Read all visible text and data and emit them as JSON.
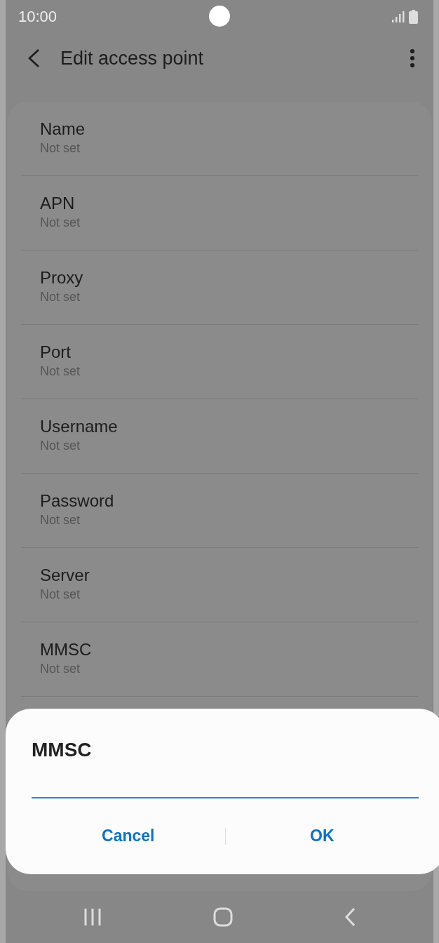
{
  "status_bar": {
    "time": "10:00"
  },
  "app_bar": {
    "title": "Edit access point"
  },
  "settings": [
    {
      "label": "Name",
      "value": "Not set"
    },
    {
      "label": "APN",
      "value": "Not set"
    },
    {
      "label": "Proxy",
      "value": "Not set"
    },
    {
      "label": "Port",
      "value": "Not set"
    },
    {
      "label": "Username",
      "value": "Not set"
    },
    {
      "label": "Password",
      "value": "Not set"
    },
    {
      "label": "Server",
      "value": "Not set"
    },
    {
      "label": "MMSC",
      "value": "Not set"
    }
  ],
  "dialog": {
    "title": "MMSC",
    "buttons": [
      "Cancel",
      "OK"
    ]
  }
}
